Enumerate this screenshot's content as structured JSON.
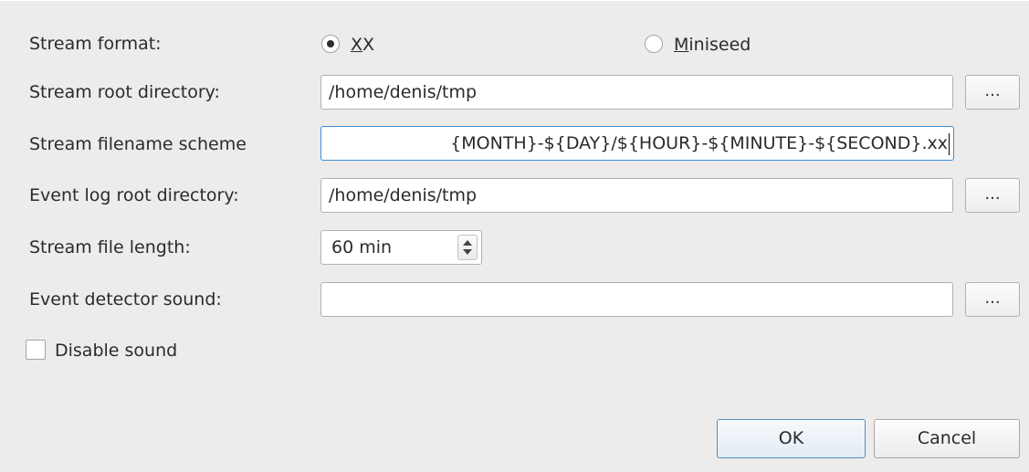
{
  "form": {
    "stream_format_label": "Stream format:",
    "stream_format_options": [
      {
        "label_mnemonic": "X",
        "label_rest": "X",
        "selected": true
      },
      {
        "label_mnemonic": "M",
        "label_rest": "iniseed",
        "selected": false
      }
    ],
    "stream_root_label": "Stream root directory:",
    "stream_root_value": "/home/denis/tmp",
    "stream_filename_label": "Stream filename scheme",
    "stream_filename_value": "{MONTH}-${DAY}/${HOUR}-${MINUTE}-${SECOND}.xx",
    "event_log_label": "Event log root directory:",
    "event_log_value": "/home/denis/tmp",
    "file_length_label": "Stream file length:",
    "file_length_value": "60 min",
    "sound_label": "Event detector sound:",
    "sound_value": "",
    "browse_label": "...",
    "disable_sound_label": "Disable sound",
    "disable_sound_checked": false
  },
  "buttons": {
    "ok_label": "OK",
    "cancel_label": "Cancel"
  }
}
